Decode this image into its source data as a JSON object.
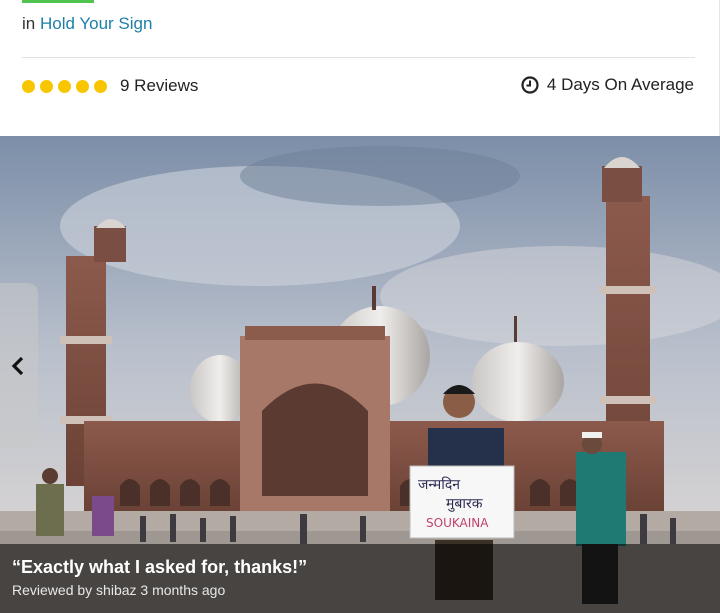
{
  "listing": {
    "category_prefix": "in",
    "category_link": "Hold Your Sign",
    "rating_stars": 5,
    "reviews_label": "9 Reviews",
    "delivery_label": "4 Days On Average"
  },
  "gallery": {
    "sign_line1": "जन्मदिन",
    "sign_line2": "मुबारक",
    "sign_line3": "SOUKAINA",
    "caption_quote": "“Exactly what I asked for, thanks!”",
    "caption_reviewer": "Reviewed by shibaz 3 months ago"
  },
  "colors": {
    "accent_green": "#4fc44f",
    "star_yellow": "#f7c600",
    "link_blue": "#1d7fa8"
  }
}
